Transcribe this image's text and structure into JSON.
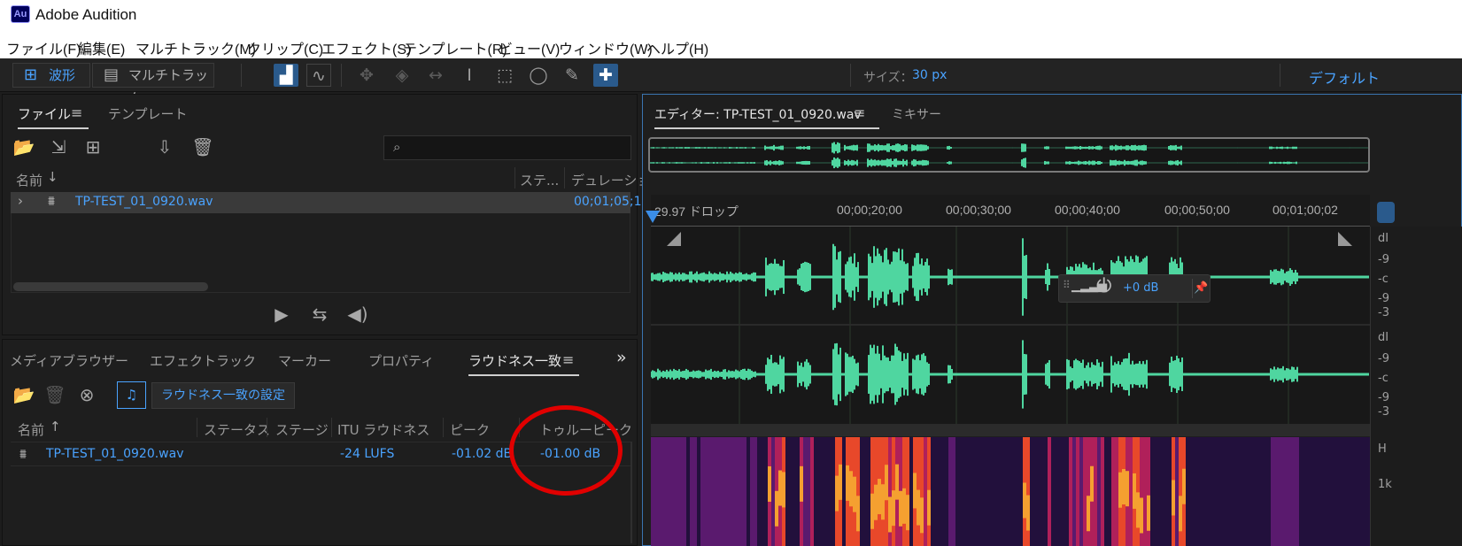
{
  "app": {
    "icon_text": "Au",
    "title": "Adobe Audition"
  },
  "menu": [
    "ファイル(F)",
    "編集(E)",
    "マルチトラック(M)",
    "クリップ(C)",
    "エフェクト(S)",
    "テンプレート(R)",
    "ビュー(V)",
    "ウィンドウ(W)",
    "ヘルプ(H)"
  ],
  "toolbar": {
    "waveform_label": "波形",
    "multitrack_label": "マルチトラック",
    "size_label": "サイズ：",
    "size_value": "30 px",
    "workspace": "デフォルト"
  },
  "files_panel": {
    "tabs": [
      "ファイル",
      "テンプレート"
    ],
    "search_placeholder": "",
    "columns": {
      "name": "名前",
      "status": "ステ...",
      "duration": "デュレーショ"
    },
    "file": {
      "name": "TP-TEST_01_0920.wav",
      "duration": "00;01;05;1"
    }
  },
  "lower_panel": {
    "tabs": [
      "メディアブラウザー",
      "エフェクトラック",
      "マーカー",
      "プロパティ",
      "ラウドネス一致"
    ],
    "settings_button": "ラウドネス一致の設定",
    "columns": [
      "名前",
      "ステータス",
      "ステージ",
      "ITU ラウドネス",
      "ピーク",
      "トゥルーピーク"
    ],
    "rows": [
      {
        "name": "TP-TEST_01_0920.wav",
        "status": "",
        "stage": "",
        "itu": "-24 LUFS",
        "peak": "-01.02 dB",
        "true_peak": "-01.00 dB"
      }
    ]
  },
  "editor": {
    "tab": "エディター: TP-TEST_01_0920.wav",
    "mixer_tab": "ミキサー",
    "timecode_mode": "29.97 ドロップ",
    "ruler": [
      "00;00;20;00",
      "00;00;30;00",
      "00;00;40;00",
      "00;00;50;00",
      "00;01;00;02"
    ],
    "hud_gain": "+0 dB",
    "scale_labels": [
      "dI",
      "-9",
      "-c",
      "-9",
      "-3",
      "dI",
      "-9",
      "-c",
      "-9",
      "-3",
      "H",
      "1k"
    ]
  },
  "colors": {
    "accent": "#4aa3ff",
    "waveform": "#4fd6a0",
    "highlight_circle": "#e10000"
  }
}
